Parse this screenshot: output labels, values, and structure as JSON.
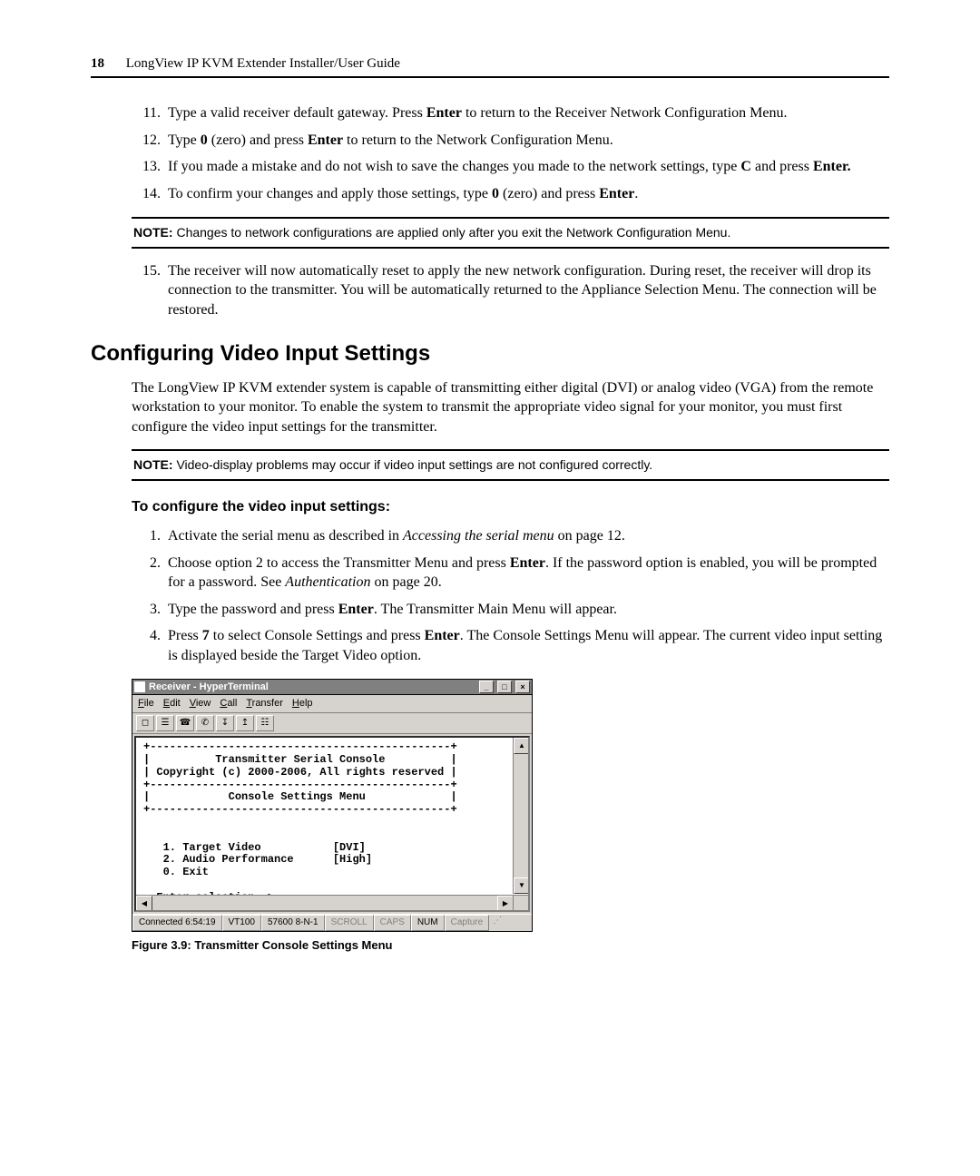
{
  "header": {
    "page_number": "18",
    "doc_title": "LongView IP KVM Extender Installer/User Guide"
  },
  "steps_first": [
    {
      "num": "11.",
      "html": "Type a valid receiver default gateway. Press <b>Enter</b> to return to the Receiver Network Configuration Menu."
    },
    {
      "num": "12.",
      "html": "Type <b>0</b> (zero) and press <b>Enter</b> to return to the Network Configuration Menu."
    },
    {
      "num": "13.",
      "html": "If you made a mistake and do not wish to save the changes you made to the network settings, type <b>C</b> and press <b>Enter.</b>"
    },
    {
      "num": "14.",
      "html": "To confirm your changes and apply those settings, type <b>0</b> (zero) and press <b>Enter</b>."
    }
  ],
  "note1": {
    "label": "NOTE:",
    "text": "Changes to network configurations are applied only after you exit the Network Configuration Menu."
  },
  "steps_second": [
    {
      "num": "15.",
      "html": "The receiver will now automatically reset to apply the new network configuration. During reset, the receiver will drop its connection to the transmitter. You will be automatically returned to the Appliance Selection Menu. The connection will be restored."
    }
  ],
  "section_title": "Configuring Video Input Settings",
  "section_intro": "The LongView IP KVM extender system is capable of transmitting either digital (DVI) or analog video (VGA) from the remote workstation to your monitor. To enable the system to transmit the appropriate video signal for your monitor, you must first configure the video input settings for the transmitter.",
  "note2": {
    "label": "NOTE:",
    "text": "Video-display problems may occur if video input settings are not configured correctly."
  },
  "subhead": "To configure the video input settings:",
  "steps_third": [
    {
      "num": "1.",
      "html": "Activate the serial menu as described in <i>Accessing the serial menu</i> on page 12."
    },
    {
      "num": "2.",
      "html": "Choose option 2 to access the Transmitter Menu and press <b>Enter</b>. If the password option is enabled, you will be prompted for a password. See <i>Authentication</i> on page 20."
    },
    {
      "num": "3.",
      "html": "Type the password and press <b>Enter</b>. The Transmitter Main Menu will appear."
    },
    {
      "num": "4.",
      "html": "Press <b>7</b> to select Console Settings and press <b>Enter</b>. The Console Settings Menu will appear. The current video input setting is displayed beside the Target Video option."
    }
  ],
  "terminal": {
    "title": "Receiver - HyperTerminal",
    "menu": [
      "File",
      "Edit",
      "View",
      "Call",
      "Transfer",
      "Help"
    ],
    "toolbar_icons": [
      "new-doc-icon",
      "open-doc-icon",
      "connect-icon",
      "disconnect-icon",
      "send-icon",
      "receive-icon",
      "properties-icon"
    ],
    "body": "+----------------------------------------------+\n|          Transmitter Serial Console          |\n| Copyright (c) 2000-2006, All rights reserved |\n+----------------------------------------------+\n|            Console Settings Menu             |\n+----------------------------------------------+\n\n\n   1. Target Video           [DVI]\n   2. Audio Performance      [High]\n   0. Exit\n\n  Enter selection ->",
    "status": {
      "connected": "Connected 6:54:19",
      "emulation": "VT100",
      "settings": "57600 8-N-1",
      "scroll": "SCROLL",
      "caps": "CAPS",
      "num": "NUM",
      "capture": "Capture"
    }
  },
  "figure_caption": "Figure 3.9: Transmitter Console Settings Menu"
}
